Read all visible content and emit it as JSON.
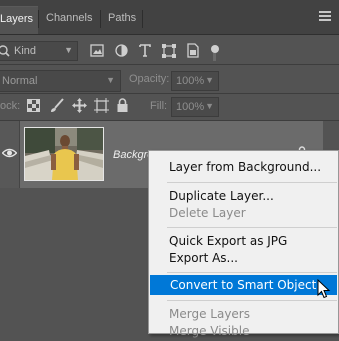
{
  "tabs": [
    {
      "label": "Layers",
      "active": true
    },
    {
      "label": "Channels",
      "active": false
    },
    {
      "label": "Paths",
      "active": false
    }
  ],
  "filter": {
    "kind_label": "Kind"
  },
  "blend": {
    "mode": "Normal",
    "opacity_label": "Opacity:",
    "opacity_value": "100%",
    "fill_label": "Fill:",
    "fill_value": "100%",
    "lock_label": "ock:"
  },
  "layer": {
    "name": "Background",
    "visible": true,
    "locked": true
  },
  "context_menu": {
    "items": [
      {
        "label": "Layer from Background...",
        "enabled": true
      },
      {
        "label": "Duplicate Layer...",
        "enabled": true
      },
      {
        "label": "Delete Layer",
        "enabled": false
      },
      {
        "label": "Quick Export as JPG",
        "enabled": true
      },
      {
        "label": "Export As...",
        "enabled": true
      },
      {
        "label": "Convert to Smart Object",
        "enabled": true,
        "highlighted": true
      },
      {
        "label": "Merge Layers",
        "enabled": false
      },
      {
        "label": "Merge Visible",
        "enabled": false
      }
    ]
  },
  "colors": {
    "panel_bg": "#535353",
    "tabbar_bg": "#424242",
    "selected_layer_bg": "#6b6b6b",
    "menu_bg": "#f0f0f0",
    "menu_highlight": "#0078d7"
  }
}
